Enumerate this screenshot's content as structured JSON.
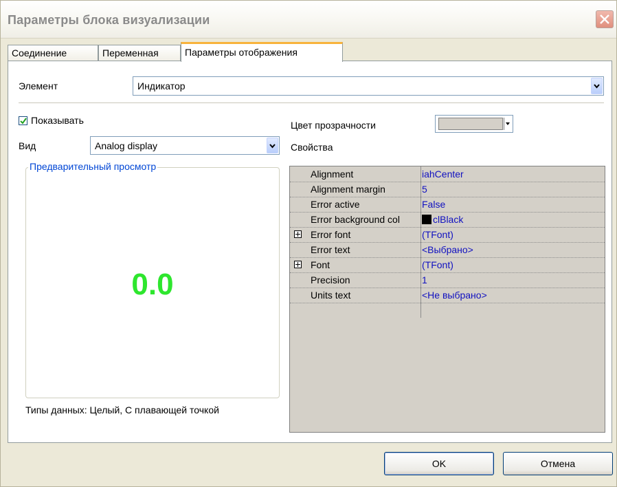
{
  "window": {
    "title": "Параметры блока визуализации"
  },
  "tabs": [
    {
      "label": "Соединение"
    },
    {
      "label": "Переменная"
    },
    {
      "label": "Параметры отображения"
    }
  ],
  "element": {
    "label": "Элемент",
    "value": "Индикатор"
  },
  "show": {
    "label": "Показывать",
    "checked": true
  },
  "view": {
    "label": "Вид",
    "value": "Analog display"
  },
  "preview": {
    "title": "Предварительный просмотр",
    "value": "0.0",
    "value_color": "#2ee62e"
  },
  "data_types": "Типы данных: Целый, С плавающей точкой",
  "transparency": {
    "label": "Цвет прозрачности"
  },
  "properties": {
    "label": "Свойства",
    "rows": [
      {
        "name": "Alignment",
        "value": "iahCenter",
        "expandable": false
      },
      {
        "name": "Alignment margin",
        "value": "5",
        "expandable": false
      },
      {
        "name": "Error active",
        "value": "False",
        "expandable": false
      },
      {
        "name": "Error background col",
        "value": "clBlack",
        "expandable": false,
        "swatch": "#000000"
      },
      {
        "name": "Error font",
        "value": "(TFont)",
        "expandable": true
      },
      {
        "name": "Error text",
        "value": "<Выбрано>",
        "expandable": false
      },
      {
        "name": "Font",
        "value": "(TFont)",
        "expandable": true
      },
      {
        "name": "Precision",
        "value": "1",
        "expandable": false
      },
      {
        "name": "Units text",
        "value": "<Не выбрано>",
        "expandable": false
      }
    ]
  },
  "buttons": {
    "ok": "OK",
    "cancel": "Отмена"
  }
}
